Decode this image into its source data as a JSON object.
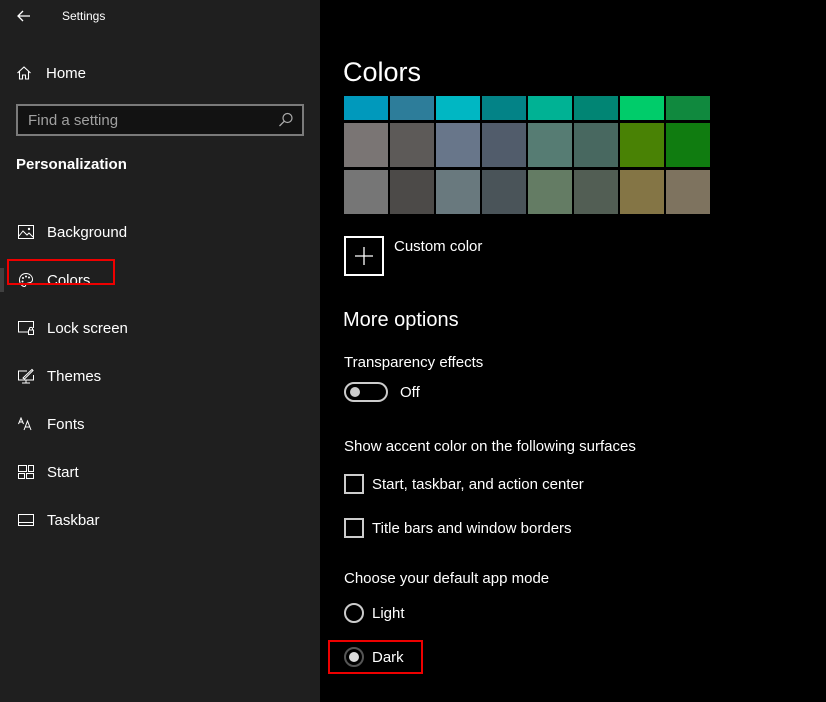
{
  "window": {
    "title": "Settings"
  },
  "sidebar": {
    "home_label": "Home",
    "search": {
      "placeholder": "Find a setting",
      "value": ""
    },
    "section_title": "Personalization",
    "items": [
      {
        "label": "Background",
        "icon": "image-icon",
        "selected": false
      },
      {
        "label": "Colors",
        "icon": "palette-icon",
        "selected": true
      },
      {
        "label": "Lock screen",
        "icon": "lock-screen-icon",
        "selected": false
      },
      {
        "label": "Themes",
        "icon": "themes-icon",
        "selected": false
      },
      {
        "label": "Fonts",
        "icon": "fonts-icon",
        "selected": false
      },
      {
        "label": "Start",
        "icon": "start-icon",
        "selected": false
      },
      {
        "label": "Taskbar",
        "icon": "taskbar-icon",
        "selected": false
      }
    ]
  },
  "main": {
    "title": "Colors",
    "swatches": [
      [
        "#0099bc",
        "#2d7d9a",
        "#00b7c3",
        "#038387",
        "#00b294",
        "#018574",
        "#00cc6a",
        "#10893e"
      ],
      [
        "#7a7574",
        "#5d5a58",
        "#68768a",
        "#515c6b",
        "#567c73",
        "#486860",
        "#498205",
        "#107c10"
      ],
      [
        "#767676",
        "#4c4a48",
        "#69797e",
        "#4a5459",
        "#647c64",
        "#525e54",
        "#847545",
        "#7e735f"
      ]
    ],
    "custom_color_label": "Custom color",
    "more_options_title": "More options",
    "transparency": {
      "label": "Transparency effects",
      "state_label": "Off",
      "on": false
    },
    "accent_surfaces": {
      "label": "Show accent color on the following surfaces",
      "options": [
        {
          "label": "Start, taskbar, and action center",
          "checked": false
        },
        {
          "label": "Title bars and window borders",
          "checked": false
        }
      ]
    },
    "app_mode": {
      "label": "Choose your default app mode",
      "options": [
        {
          "label": "Light",
          "selected": false
        },
        {
          "label": "Dark",
          "selected": true
        }
      ]
    }
  },
  "colors": {
    "sidebar_bg": "#1f1f1f",
    "main_bg": "#000000",
    "highlight": "#e00000"
  }
}
